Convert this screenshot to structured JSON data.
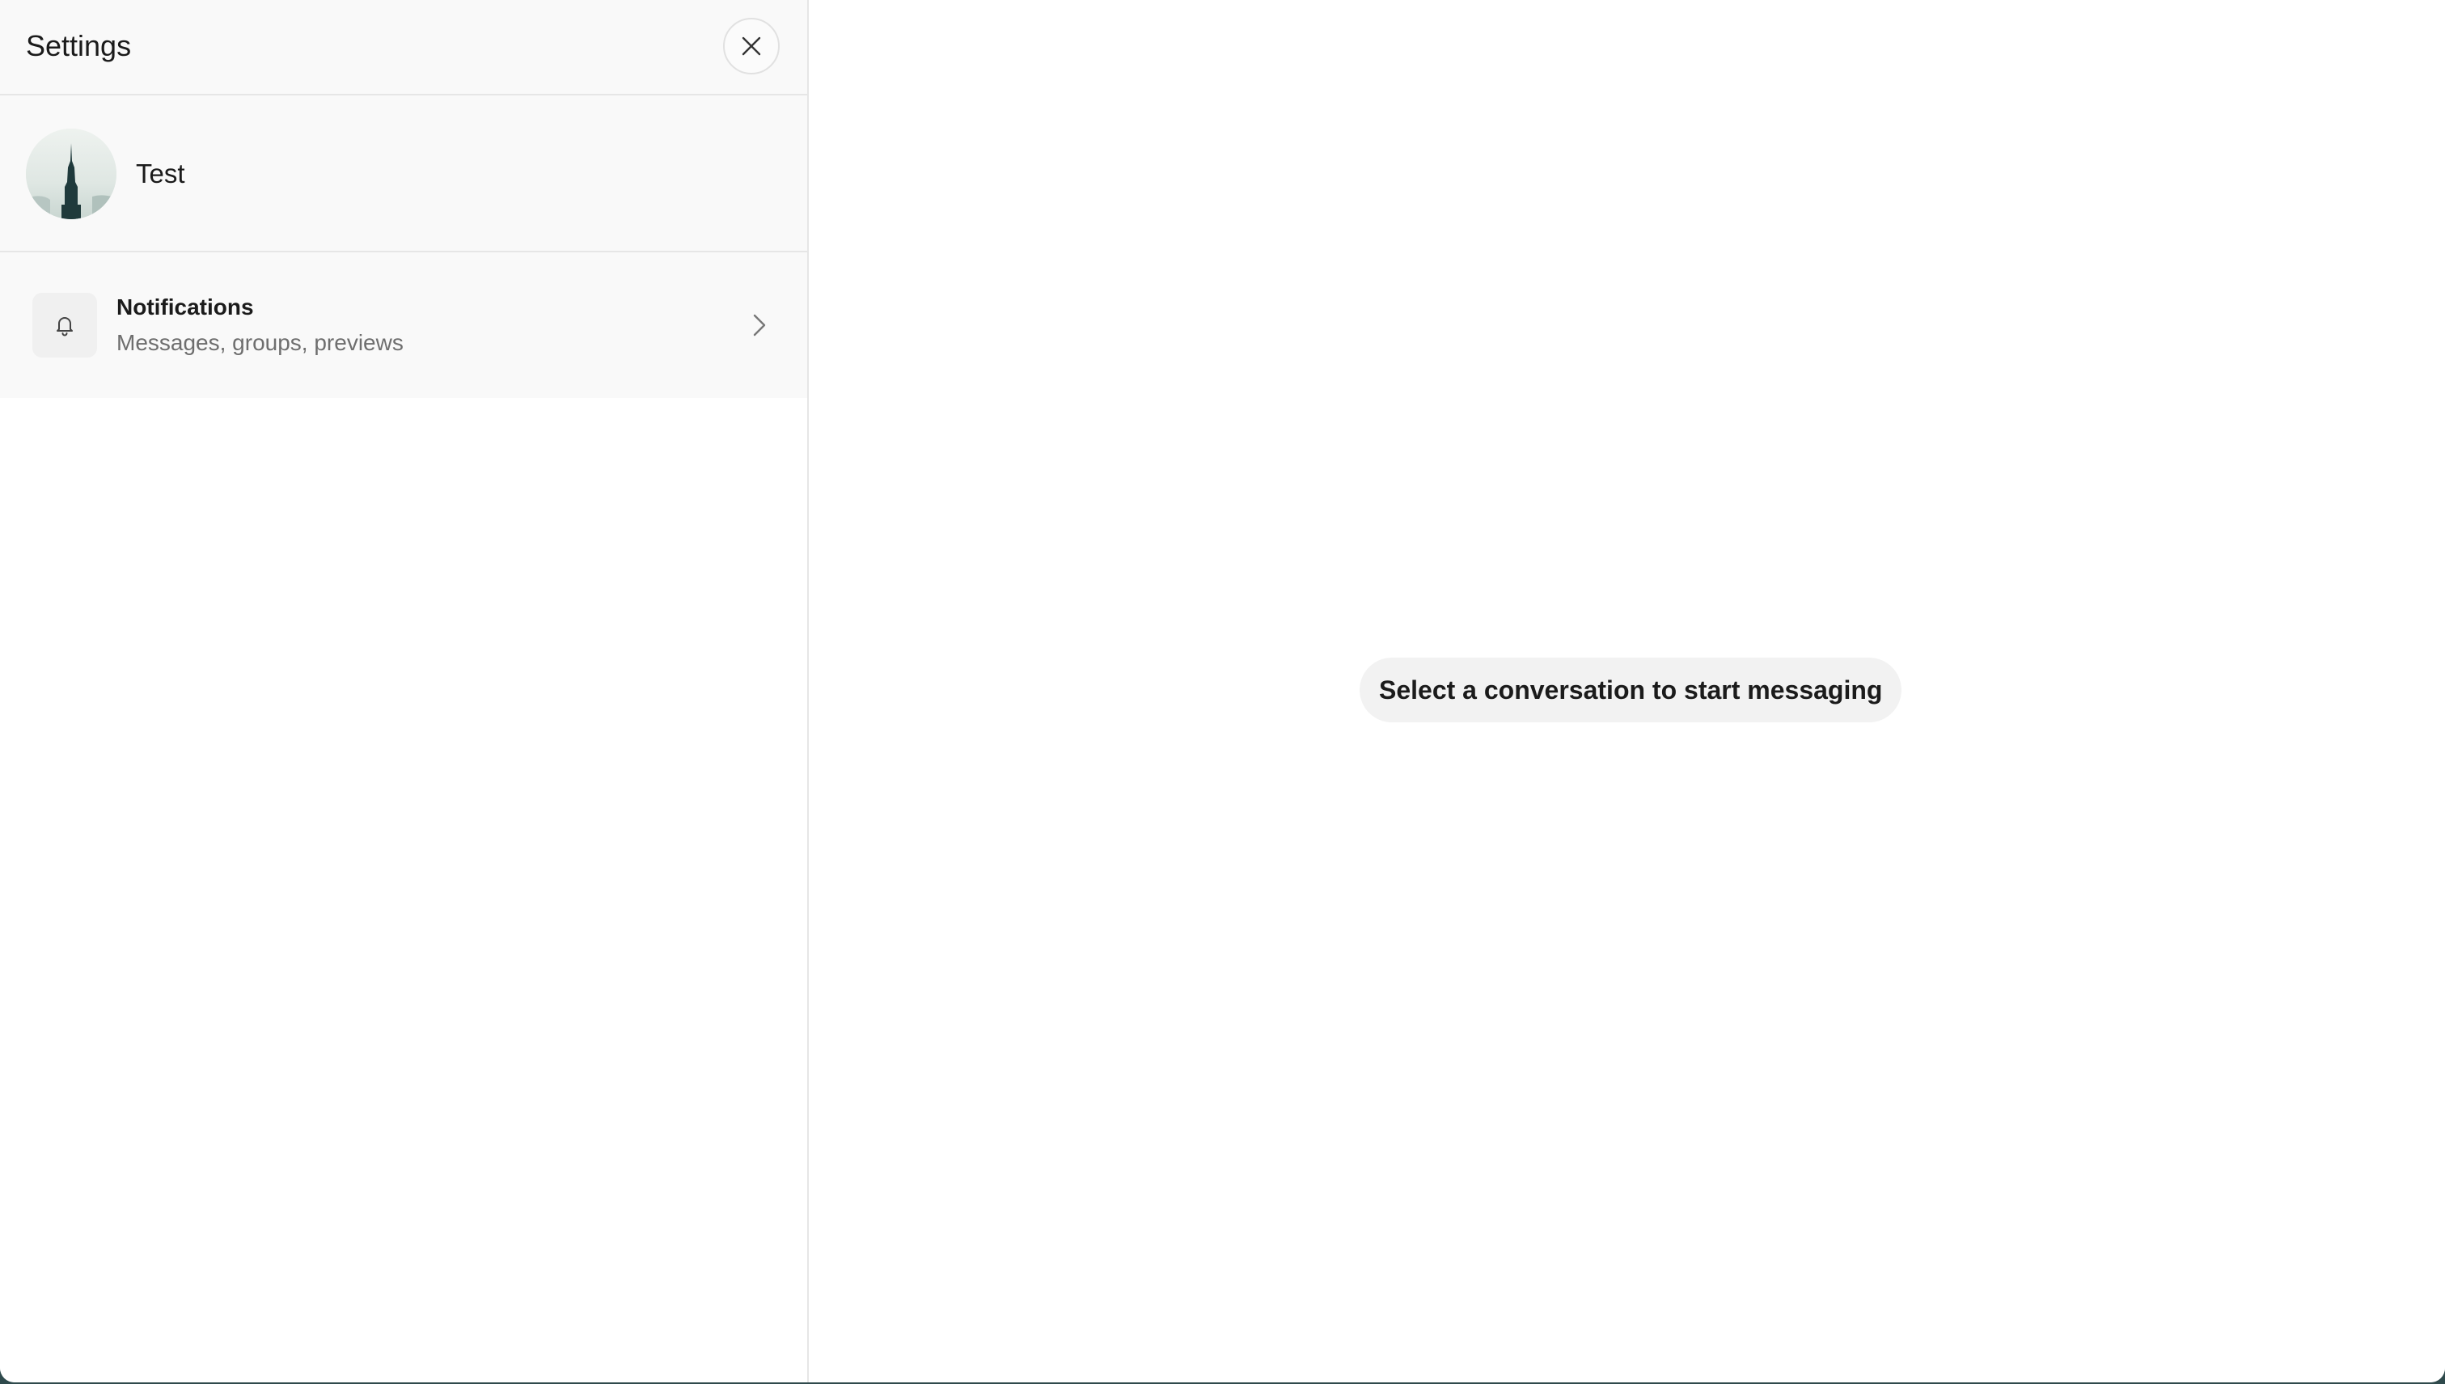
{
  "sidebar": {
    "title": "Settings",
    "close_icon": "close-icon",
    "profile": {
      "name": "Test",
      "avatar_icon": "avatar-photo"
    },
    "items": [
      {
        "title": "Notifications",
        "subtitle": "Messages, groups, previews",
        "icon": "bell-icon",
        "chevron_icon": "chevron-right-icon"
      }
    ]
  },
  "main": {
    "empty_state": "Select a conversation to start messaging"
  },
  "colors": {
    "panel_bg": "#f9f9f9",
    "divider": "#e6e6e6",
    "text_primary": "#1b1b1b",
    "text_secondary": "#6e6e6e",
    "pill_bg": "#f2f2f2",
    "window_backdrop": "#2f4a4c"
  }
}
